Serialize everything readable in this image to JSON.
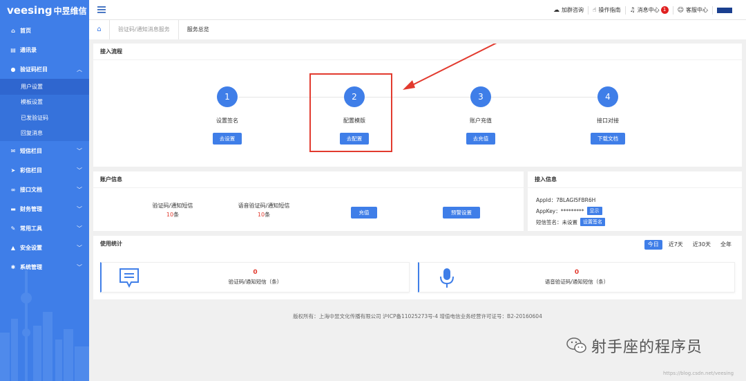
{
  "brand": {
    "name": "veesing",
    "cn": "中昱维信"
  },
  "sidebar": {
    "items": [
      {
        "label": "首页",
        "icon": "home-icon"
      },
      {
        "label": "通讯录",
        "icon": "contacts-icon"
      },
      {
        "label": "验证码栏目",
        "icon": "chat-icon",
        "expanded": true,
        "children": [
          {
            "label": "用户设置",
            "active": true
          },
          {
            "label": "模板设置"
          },
          {
            "label": "已发验证码"
          },
          {
            "label": "回复消息"
          }
        ]
      },
      {
        "label": "短信栏目",
        "icon": "mail-icon"
      },
      {
        "label": "彩信栏目",
        "icon": "send-icon"
      },
      {
        "label": "接口文档",
        "icon": "link-icon"
      },
      {
        "label": "财务管理",
        "icon": "card-icon"
      },
      {
        "label": "常用工具",
        "icon": "wrench-icon"
      },
      {
        "label": "安全设置",
        "icon": "warning-icon"
      },
      {
        "label": "系统管理",
        "icon": "gear-icon"
      }
    ]
  },
  "topbar": {
    "links": [
      {
        "label": "加群咨询",
        "icon": "cloud-icon"
      },
      {
        "label": "操作指南",
        "icon": "hand-icon"
      },
      {
        "label": "消息中心",
        "icon": "bell-icon",
        "badge": "1"
      },
      {
        "label": "客服中心",
        "icon": "user-icon"
      }
    ]
  },
  "breadcrumb": {
    "parent": "验证码/通知消息服务",
    "current": "服务总览"
  },
  "flow": {
    "title": "接入流程",
    "steps": [
      {
        "num": "1",
        "label": "设置签名",
        "button": "去设置"
      },
      {
        "num": "2",
        "label": "配置模版",
        "button": "去配置"
      },
      {
        "num": "3",
        "label": "账户充值",
        "button": "去充值"
      },
      {
        "num": "4",
        "label": "接口对接",
        "button": "下载文档"
      }
    ]
  },
  "account": {
    "title": "账户信息",
    "sms_label": "验证码/通知短信",
    "sms_count": "10",
    "voice_label": "语音验证码/通知短信",
    "voice_count": "10",
    "unit": "条",
    "recharge_button": "充值",
    "alert_button": "预警设置"
  },
  "access": {
    "title": "接入信息",
    "appid_label": "AppId：",
    "appid_value": "7BLAGI5FBR6H",
    "appkey_label": "AppKey：",
    "appkey_value": "*********",
    "show_button": "显示",
    "sign_label": "短信签名：",
    "sign_value": "未设置",
    "sign_button": "设置签名"
  },
  "usage": {
    "title": "使用统计",
    "ranges": [
      {
        "label": "今日",
        "active": true
      },
      {
        "label": "近7天"
      },
      {
        "label": "近30天"
      },
      {
        "label": "全年"
      }
    ],
    "sms": {
      "count": "0",
      "label": "验证码/通知短信（条）"
    },
    "voice": {
      "count": "0",
      "label": "语音验证码/通知短信（条）"
    }
  },
  "footer": "版权所有：上海中昱文化传播有限公司 沪ICP备11025273号-4 增值电信业务经营许可证号：B2-20160604",
  "watermark": {
    "text": "射手座的程序员",
    "url": "https://blog.csdn.net/veesing"
  },
  "colors": {
    "accent": "#3f7ee8",
    "danger": "#e23a2e"
  }
}
